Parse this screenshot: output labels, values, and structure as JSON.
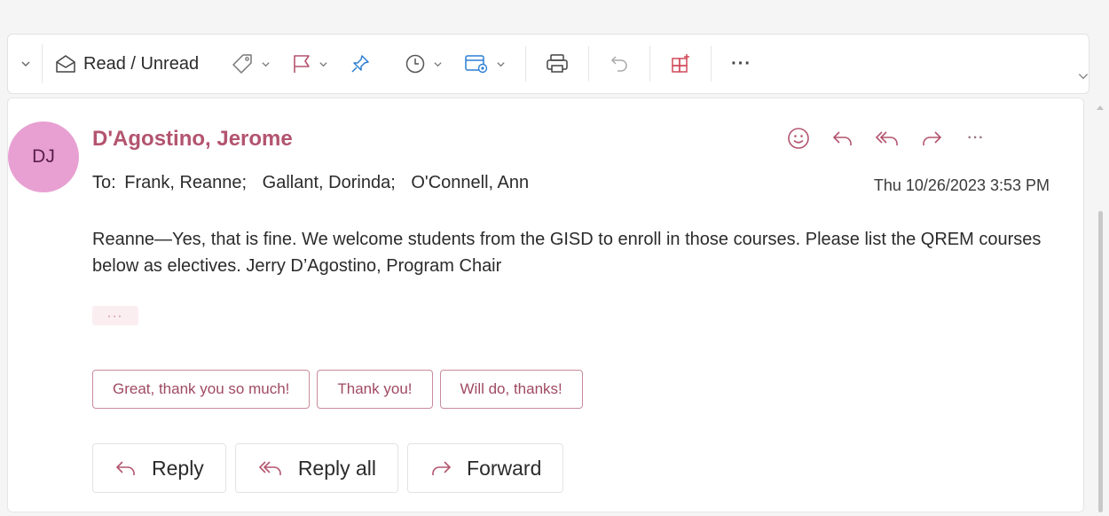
{
  "toolbar": {
    "read_unread_label": "Read / Unread",
    "more_label": "···"
  },
  "message": {
    "avatar_initials": "DJ",
    "sender": "D'Agostino, Jerome",
    "to_label": "To:",
    "recipients": [
      "Frank, Reanne;",
      "Gallant, Dorinda;",
      "O'Connell, Ann"
    ],
    "date": "Thu 10/26/2023 3:53 PM",
    "body": "Reanne—Yes, that is fine. We welcome students from the GISD to enroll in those courses. Please list the QREM courses below as electives. Jerry D’Agostino, Program Chair",
    "expand_label": "···",
    "more_actions_label": "···"
  },
  "suggested_replies": [
    "Great, thank you so much!",
    "Thank you!",
    "Will do, thanks!"
  ],
  "response_buttons": {
    "reply": "Reply",
    "reply_all": "Reply all",
    "forward": "Forward"
  },
  "colors": {
    "accent": "#b3546f",
    "avatar_bg": "#e8a0d2",
    "pin_blue": "#2b7fd4"
  },
  "icons": [
    "chevron-down-icon",
    "envelope-open-icon",
    "tag-icon",
    "flag-icon",
    "pin-icon",
    "clock-icon",
    "rules-icon",
    "print-icon",
    "undo-icon",
    "apps-icon",
    "more-icon",
    "emoji-icon",
    "reply-icon",
    "reply-all-icon",
    "forward-icon"
  ]
}
